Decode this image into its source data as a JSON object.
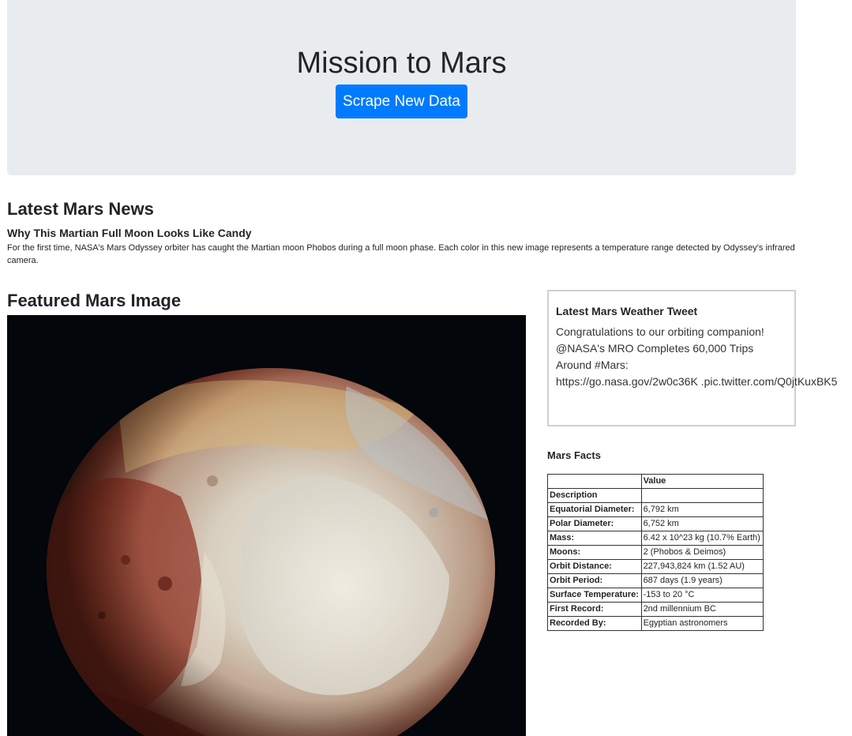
{
  "header": {
    "title": "Mission to Mars",
    "scrape_button_label": "Scrape New Data",
    "scrape_button_color": "#007bff"
  },
  "news": {
    "heading": "Latest Mars News",
    "title": "Why This Martian Full Moon Looks Like Candy",
    "paragraph": "For the first time, NASA's Mars Odyssey orbiter has caught the Martian moon Phobos during a full moon phase. Each color in this new image represents a temperature range detected by Odyssey's infrared camera."
  },
  "featured_image": {
    "heading": "Featured Mars Image"
  },
  "weather": {
    "heading": "Latest Mars Weather Tweet",
    "lines": [
      "Congratulations to our orbiting companion!",
      "@NASA's MRO Completes 60,000 Trips",
      "Around #Mars:",
      "https://go.nasa.gov/2w0c36K .pic.twitter.com/Q0jtKuxBK5"
    ]
  },
  "facts": {
    "heading": "Mars Facts",
    "columns": [
      "",
      "Value"
    ],
    "index_label": "Description",
    "rows": [
      {
        "label": "Equatorial Diameter:",
        "value": "6,792 km"
      },
      {
        "label": "Polar Diameter:",
        "value": "6,752 km"
      },
      {
        "label": "Mass:",
        "value": "6.42 x 10^23 kg (10.7% Earth)"
      },
      {
        "label": "Moons:",
        "value": "2 (Phobos & Deimos)"
      },
      {
        "label": "Orbit Distance:",
        "value": "227,943,824 km (1.52 AU)"
      },
      {
        "label": "Orbit Period:",
        "value": "687 days (1.9 years)"
      },
      {
        "label": "Surface Temperature:",
        "value": "-153 to 20 °C"
      },
      {
        "label": "First Record:",
        "value": "2nd millennium BC"
      },
      {
        "label": "Recorded By:",
        "value": "Egyptian astronomers"
      }
    ]
  }
}
